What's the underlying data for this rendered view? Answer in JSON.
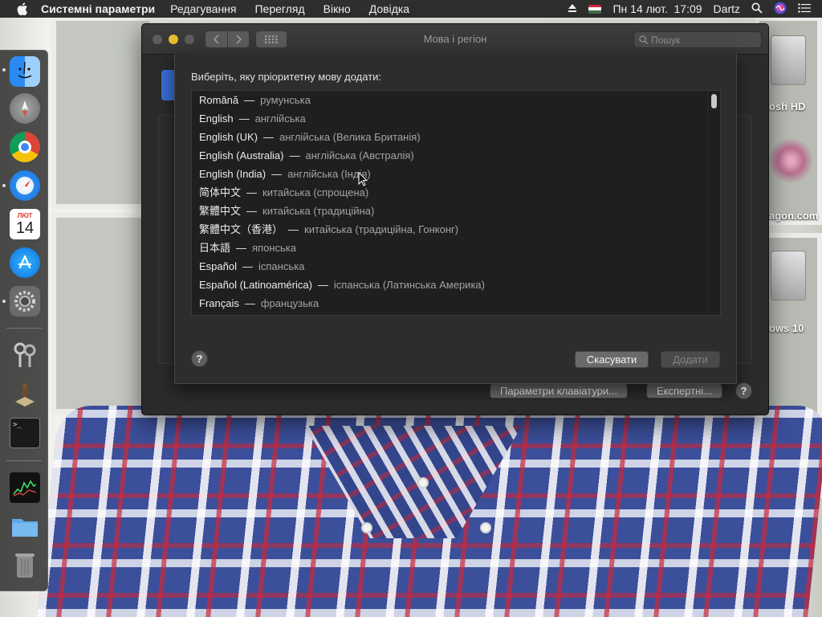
{
  "menubar": {
    "app_name": "Системні параметри",
    "menus": [
      "Редагування",
      "Перегляд",
      "Вікно",
      "Довідка"
    ],
    "clock": "Пн 14 лют.  17:09",
    "user": "Dartz"
  },
  "dock": {
    "calendar_month": "ЛЮТ",
    "calendar_day": "14",
    "apps": [
      "Finder",
      "Launchpad",
      "Google Chrome",
      "Safari",
      "Calendar",
      "App Store",
      "System Preferences",
      "Keychain Access",
      "Chess",
      "Terminal",
      "Activity Monitor",
      "Documents",
      "Trash"
    ]
  },
  "desktop": {
    "icons": [
      {
        "label": "osh HD"
      },
      {
        "label": "agon.com"
      },
      {
        "label": "ows 10"
      }
    ]
  },
  "window": {
    "title": "Мова і регіон",
    "search_placeholder": "Пошук",
    "keyboard_prefs_label": "Параметри клавіатури...",
    "advanced_label": "Експертні...",
    "help_label": "?"
  },
  "sheet": {
    "prompt": "Виберіть, яку пріоритетну мову додати:",
    "languages": [
      {
        "native": "Română",
        "localized": "румунська"
      },
      {
        "native": "English",
        "localized": "англійська"
      },
      {
        "native": "English (UK)",
        "localized": "англійська (Велика Британія)"
      },
      {
        "native": "English (Australia)",
        "localized": "англійська (Австралія)"
      },
      {
        "native": "English (India)",
        "localized": "англійська (Індія)"
      },
      {
        "native": "简体中文",
        "localized": "китайська (спрощена)"
      },
      {
        "native": "繁體中文",
        "localized": "китайська (традиційна)"
      },
      {
        "native": "繁體中文（香港）",
        "localized": "китайська (традиційна, Гонконг)"
      },
      {
        "native": "日本語",
        "localized": "японська"
      },
      {
        "native": "Español",
        "localized": "іспанська"
      },
      {
        "native": "Español (Latinoamérica)",
        "localized": "іспанська (Латинська Америка)"
      },
      {
        "native": "Français",
        "localized": "французька"
      }
    ],
    "separator": "—",
    "help_label": "?",
    "cancel_label": "Скасувати",
    "add_label": "Додати"
  },
  "colors": {
    "close": "#ec5f57",
    "minimize": "#e6bd2e",
    "maximize": "#5c5c5c",
    "accent": "#5a5a5a"
  }
}
